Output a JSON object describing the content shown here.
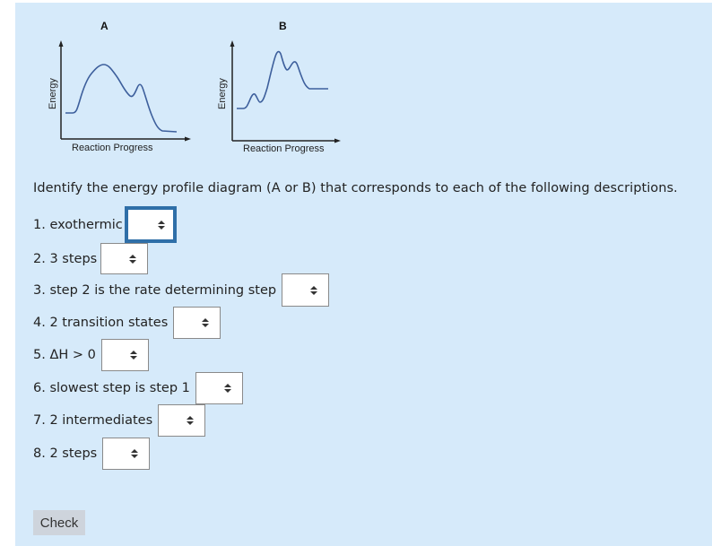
{
  "diagrams": [
    {
      "id": "A",
      "title": "A",
      "xlabel": "Reaction Progress",
      "ylabel": "Energy",
      "profile": "two peaks; higher first peak, lower second peak; products lower than reactants"
    },
    {
      "id": "B",
      "title": "B",
      "xlabel": "Reaction Progress",
      "ylabel": "Energy",
      "profile": "three peaks; small first peak, tallest second peak, medium third peak; products higher than reactants"
    }
  ],
  "curve_color": "#3d5f9c",
  "prompt": "Identify the energy profile diagram (A or B) that corresponds to each of the following descriptions.",
  "questions": [
    {
      "label": "1. exothermic",
      "value": "",
      "focused": true
    },
    {
      "label": "2. 3 steps",
      "value": ""
    },
    {
      "label": "3. step 2 is the rate determining step",
      "value": ""
    },
    {
      "label": "4. 2 transition states",
      "value": ""
    },
    {
      "label": "5. ΔH > 0",
      "value": ""
    },
    {
      "label": "6. slowest step is step 1",
      "value": ""
    },
    {
      "label": "7. 2 intermediates",
      "value": ""
    },
    {
      "label": "8. 2 steps",
      "value": ""
    }
  ],
  "select_icon": "up-down-arrows-icon",
  "check_button": "Check"
}
